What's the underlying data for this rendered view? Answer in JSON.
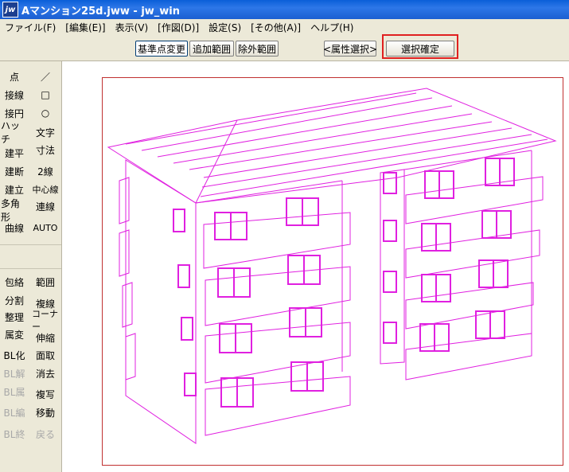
{
  "window": {
    "title": "Aマンション25d.jww - jw_win",
    "icon": "jw-app-icon"
  },
  "menu": [
    "ファイル(F)",
    "[編集(E)]",
    "表示(V)",
    "[作図(D)]",
    "設定(S)",
    "[その他(A)]",
    "ヘルプ(H)"
  ],
  "toolbar": {
    "base_point": "基準点変更",
    "add_range": "追加範囲",
    "exclude_range": "除外範囲",
    "attr_select": "<属性選択>",
    "confirm": "選択確定"
  },
  "tools_left": [
    "点",
    "接線",
    "接円",
    "ハッチ",
    "建平",
    "建断",
    "建立",
    "多角形",
    "曲線",
    "包絡",
    "分割",
    "整理",
    "属変",
    "BL化",
    "BL解",
    "BL属",
    "BL編",
    "BL終"
  ],
  "tools_right": [
    "／",
    "□",
    "○",
    "文字",
    "寸法",
    "2線",
    "中心線",
    "連線",
    "AUTO",
    "範囲",
    "複線",
    "コーナー",
    "伸縮",
    "面取",
    "消去",
    "複写",
    "移動",
    "戻る"
  ],
  "colors": {
    "drawing": "#e020e0",
    "highlight": "#e02020",
    "sheet_border": "#c03030"
  }
}
